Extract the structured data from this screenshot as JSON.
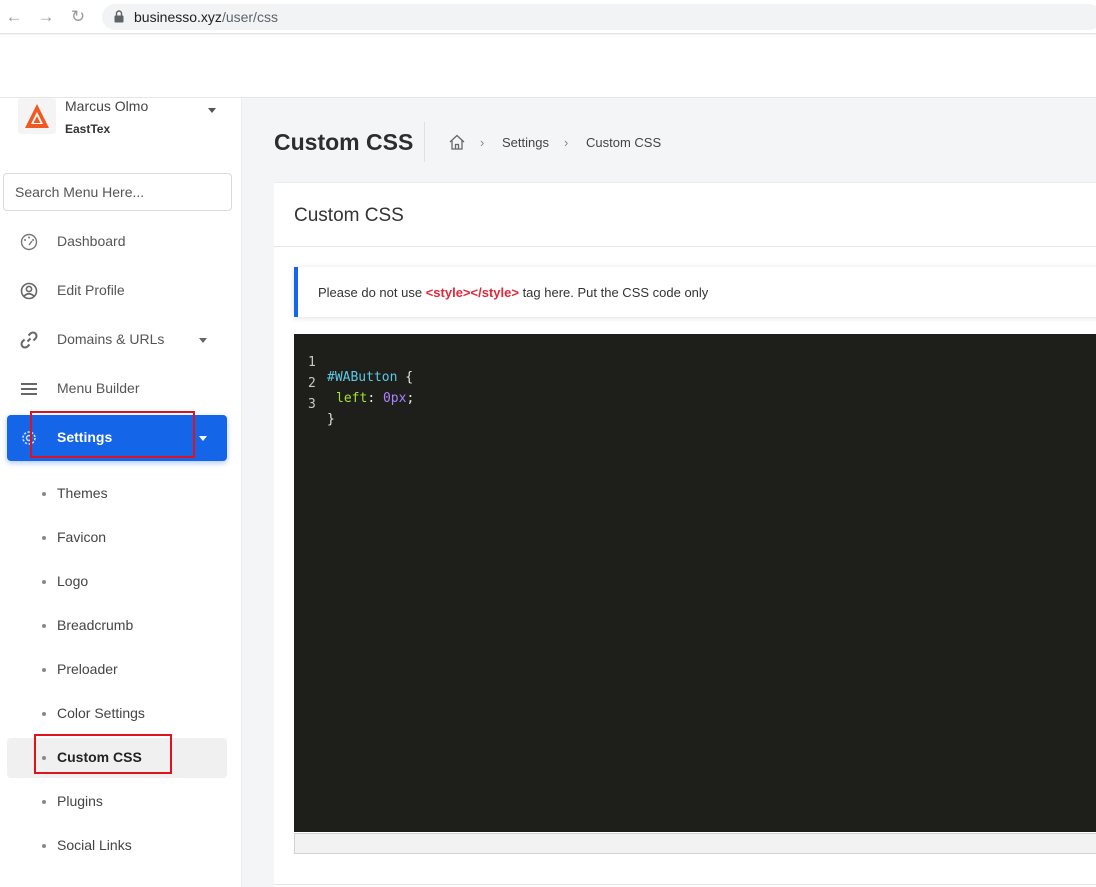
{
  "browser": {
    "url_domain": "businesso.xyz",
    "url_path": "/user/css"
  },
  "profile": {
    "name": "Marcus Olmo",
    "org": "EastTex"
  },
  "search": {
    "placeholder": "Search Menu Here..."
  },
  "menu": {
    "items": [
      {
        "label": "Dashboard",
        "icon": "dashboard-icon"
      },
      {
        "label": "Edit Profile",
        "icon": "user-circle-icon"
      },
      {
        "label": "Domains & URLs",
        "icon": "link-icon"
      },
      {
        "label": "Menu Builder",
        "icon": "hamburger-icon"
      },
      {
        "label": "Settings",
        "icon": "gear-icon"
      }
    ],
    "settings_sub": [
      {
        "label": "Themes"
      },
      {
        "label": "Favicon"
      },
      {
        "label": "Logo"
      },
      {
        "label": "Breadcrumb"
      },
      {
        "label": "Preloader"
      },
      {
        "label": "Color Settings"
      },
      {
        "label": "Custom CSS"
      },
      {
        "label": "Plugins"
      },
      {
        "label": "Social Links"
      }
    ]
  },
  "page": {
    "title": "Custom CSS",
    "breadcrumb": [
      "Settings",
      "Custom CSS"
    ]
  },
  "card": {
    "title": "Custom CSS",
    "alert_prefix": "Please do not use ",
    "alert_code": "<style></style>",
    "alert_suffix": " tag here. Put the CSS code only"
  },
  "editor": {
    "lines": [
      {
        "num": "1",
        "sel": "#WAButton",
        "rest": " {"
      },
      {
        "num": "2",
        "prop": "left",
        "colon": ": ",
        "value": "0px",
        "end": ";"
      },
      {
        "num": "3",
        "close": "}"
      }
    ]
  },
  "colors": {
    "accent": "#1565e8",
    "highlight_red": "#e0121e",
    "editor_bg": "#1e1e1b"
  }
}
